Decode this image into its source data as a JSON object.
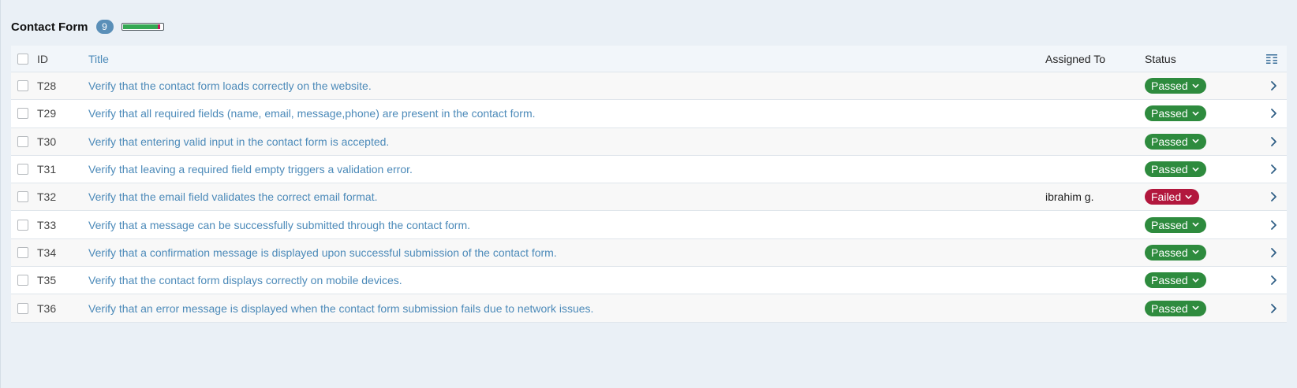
{
  "section": {
    "title": "Contact Form",
    "count": "9",
    "progress": {
      "passed": 8,
      "failed": 1,
      "total": 9
    }
  },
  "table": {
    "columns": {
      "id": "ID",
      "title": "Title",
      "assigned": "Assigned To",
      "status": "Status"
    },
    "rows": [
      {
        "id": "T28",
        "title": "Verify that the contact form loads correctly on the website.",
        "assigned": "",
        "status": "Passed"
      },
      {
        "id": "T29",
        "title": "Verify that all required fields (name, email, message,phone) are present in the contact form.",
        "assigned": "",
        "status": "Passed"
      },
      {
        "id": "T30",
        "title": "Verify that entering valid input in the contact form is accepted.",
        "assigned": "",
        "status": "Passed"
      },
      {
        "id": "T31",
        "title": "Verify that leaving a required field empty triggers a validation error.",
        "assigned": "",
        "status": "Passed"
      },
      {
        "id": "T32",
        "title": "Verify that the email field validates the correct email format.",
        "assigned": "ibrahim g.",
        "status": "Failed"
      },
      {
        "id": "T33",
        "title": "Verify that a message can be successfully submitted through the contact form.",
        "assigned": "",
        "status": "Passed"
      },
      {
        "id": "T34",
        "title": "Verify that a confirmation message is displayed upon successful submission of the contact form.",
        "assigned": "",
        "status": "Passed"
      },
      {
        "id": "T35",
        "title": "Verify that the contact form displays correctly on mobile devices.",
        "assigned": "",
        "status": "Passed"
      },
      {
        "id": "T36",
        "title": "Verify that an error message is displayed when the contact form submission fails due to network issues.",
        "assigned": "",
        "status": "Passed"
      }
    ]
  },
  "icons": {
    "columns": "column-settings-icon",
    "row_open": "chevron-right-icon",
    "status_menu": "chevron-down-icon"
  },
  "colors": {
    "passed": "#2e8b3e",
    "failed": "#b2173d",
    "link": "#4c8ab9",
    "badge": "#5a8fb8"
  }
}
